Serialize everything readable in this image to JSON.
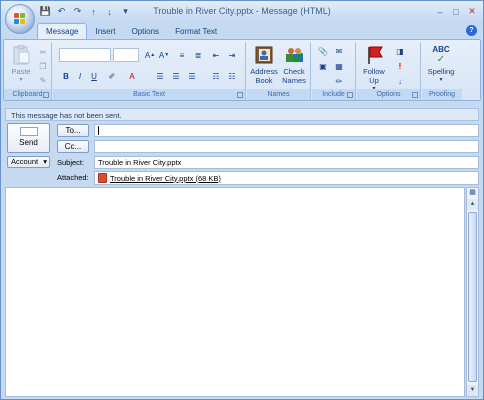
{
  "window": {
    "title": "Trouble in River City.pptx - Message (HTML)"
  },
  "tabs": [
    {
      "label": "Message",
      "active": true
    },
    {
      "label": "Insert",
      "active": false
    },
    {
      "label": "Options",
      "active": false
    },
    {
      "label": "Format Text",
      "active": false
    }
  ],
  "ribbon": {
    "clipboard": {
      "paste_label": "Paste",
      "group_label": "Clipboard"
    },
    "basic_text": {
      "group_label": "Basic Text"
    },
    "names": {
      "address_book_label": "Address Book",
      "check_names_label": "Check Names",
      "group_label": "Names"
    },
    "include": {
      "group_label": "Include"
    },
    "options": {
      "follow_up_label": "Follow Up",
      "group_label": "Options"
    },
    "proofing": {
      "spelling_label": "Spelling",
      "group_label": "Proofing",
      "abc": "ABC"
    }
  },
  "infobar": {
    "text": "This message has not been sent."
  },
  "header": {
    "send_label": "Send",
    "to_label": "To...",
    "cc_label": "Cc...",
    "account_label": "Account",
    "subject_label": "Subject:",
    "subject_value": "Trouble in River City.pptx",
    "attached_label": "Attached:",
    "attachment": "Trouble in River City.pptx (68 KB)"
  }
}
